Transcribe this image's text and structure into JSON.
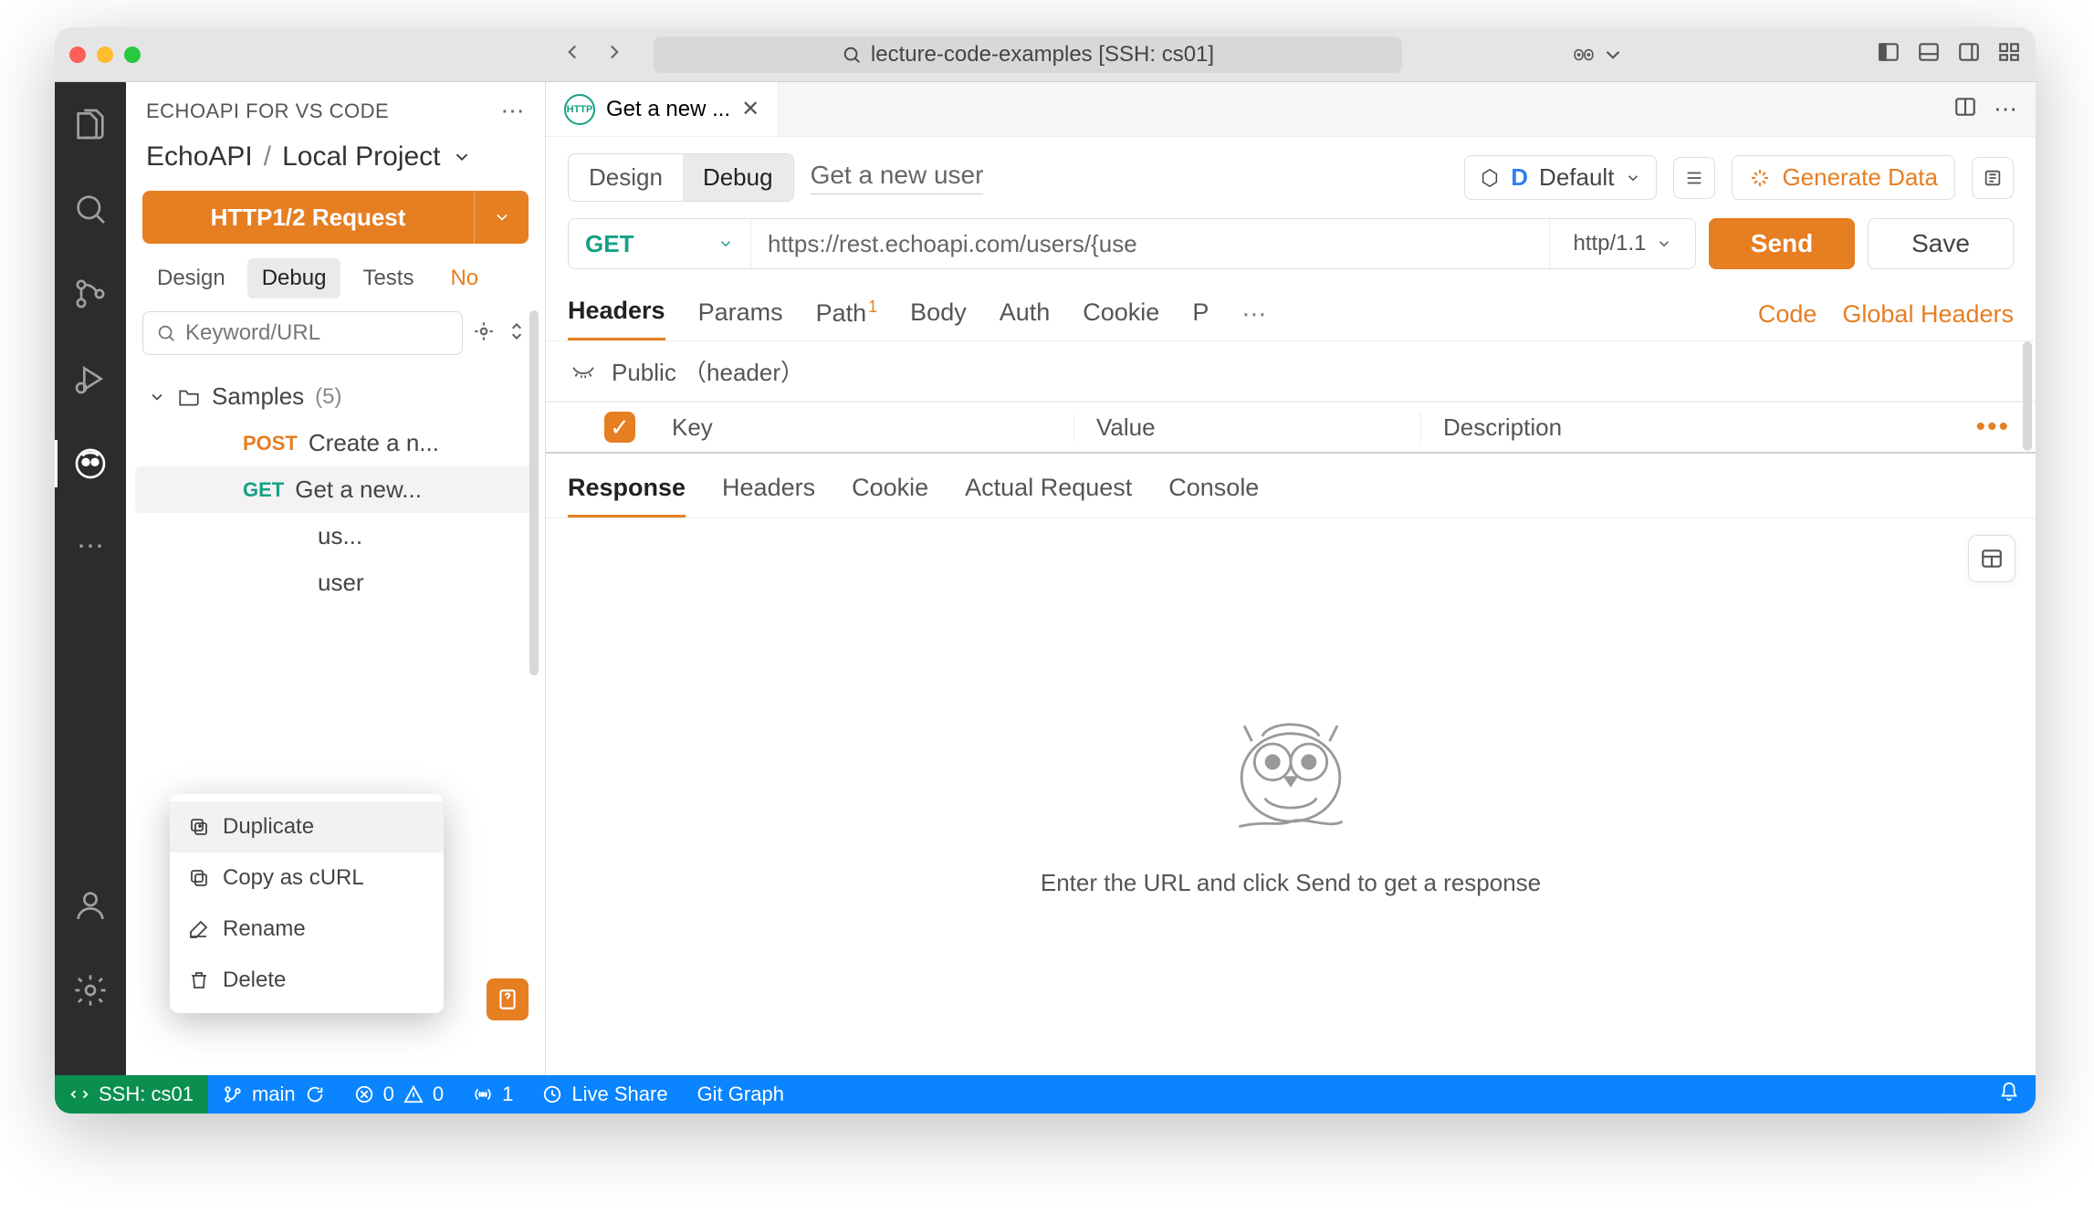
{
  "titlebar": {
    "workspace": "lecture-code-examples [SSH: cs01]"
  },
  "sidebar": {
    "extension_title": "ECHOAPI FOR VS CODE",
    "crumb_root": "EchoAPI",
    "crumb_project": "Local Project",
    "request_btn": "HTTP1/2 Request",
    "mini_tabs": {
      "design": "Design",
      "debug": "Debug",
      "tests": "Tests",
      "notice": "No"
    },
    "search_placeholder": "Keyword/URL",
    "folder": {
      "name": "Samples",
      "count": "(5)"
    },
    "items": [
      {
        "method": "POST",
        "name": "Create a n..."
      },
      {
        "method": "GET",
        "name": "Get a new..."
      },
      {
        "method": "",
        "name": "us..."
      },
      {
        "method": "",
        "name": "user"
      }
    ],
    "context_menu": [
      {
        "icon": "duplicate",
        "label": "Duplicate"
      },
      {
        "icon": "copy",
        "label": "Copy as cURL"
      },
      {
        "icon": "rename",
        "label": "Rename"
      },
      {
        "icon": "delete",
        "label": "Delete"
      }
    ]
  },
  "editor": {
    "tab_icon": "HTTP",
    "tab_title": "Get a new ...",
    "seg": {
      "design": "Design",
      "debug": "Debug"
    },
    "request_name": "Get a new user",
    "env": {
      "letter": "D",
      "name": "Default"
    },
    "generate_data": "Generate Data",
    "method": "GET",
    "url": "https://rest.echoapi.com/users/{use",
    "protocol": "http/1.1",
    "send": "Send",
    "save": "Save",
    "req_tabs": {
      "headers": "Headers",
      "params": "Params",
      "path": "Path",
      "path_badge": "1",
      "body": "Body",
      "auth": "Auth",
      "cookie": "Cookie",
      "pre": "P",
      "code": "Code",
      "global": "Global Headers"
    },
    "public_header": "Public （header）",
    "columns": {
      "key": "Key",
      "value": "Value",
      "description": "Description"
    }
  },
  "response": {
    "tabs": {
      "response": "Response",
      "headers": "Headers",
      "cookie": "Cookie",
      "actual": "Actual Request",
      "console": "Console"
    },
    "empty": "Enter the URL and click Send to get a response"
  },
  "statusbar": {
    "ssh": "SSH: cs01",
    "branch": "main",
    "errors": "0",
    "warnings": "0",
    "radio": "1",
    "liveshare": "Live Share",
    "gitgraph": "Git Graph"
  }
}
